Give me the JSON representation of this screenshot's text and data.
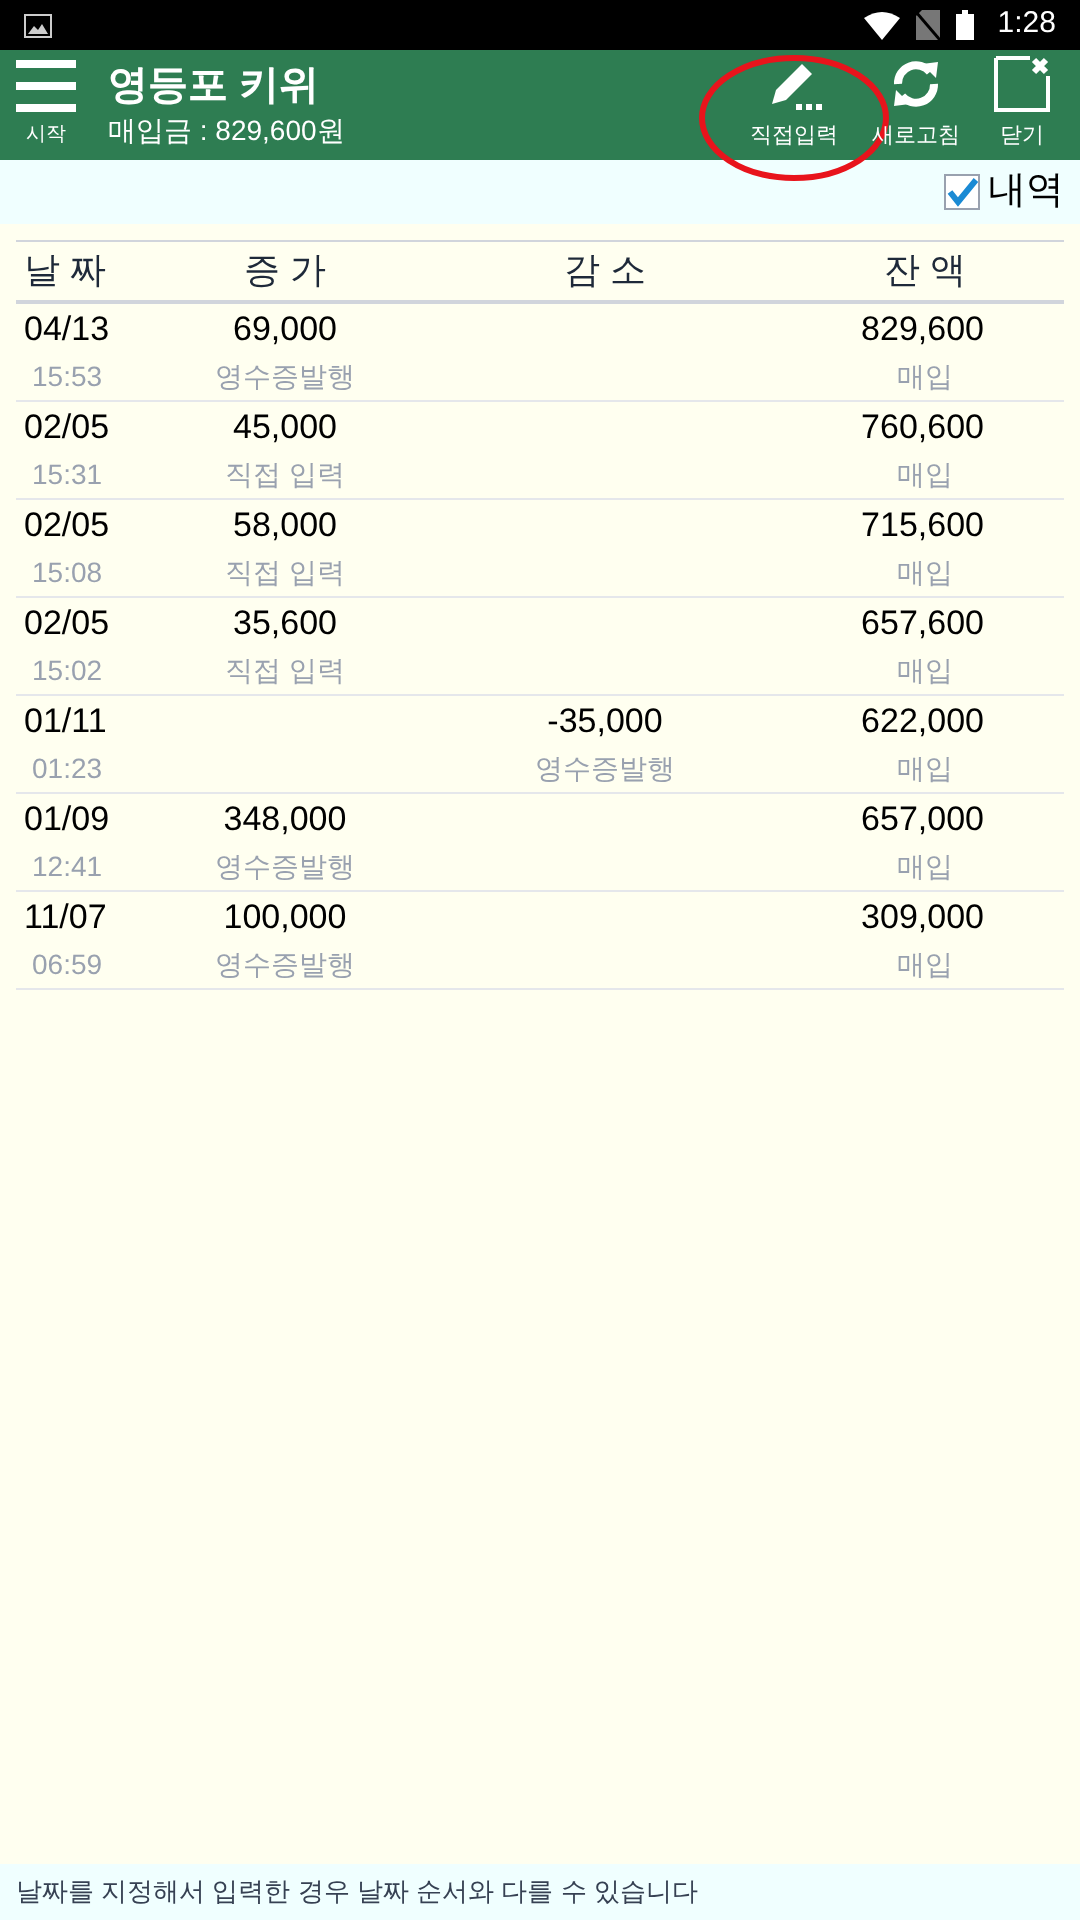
{
  "status_bar": {
    "time": "1:28"
  },
  "app_bar": {
    "menu_label": "시작",
    "title": "영등포 키위",
    "subtitle": "매입금 : 829,600원",
    "actions": [
      {
        "kind": "pencil",
        "label": "직접입력",
        "circled": true
      },
      {
        "kind": "refresh",
        "label": "새로고침",
        "circled": false
      },
      {
        "kind": "close",
        "label": "닫기",
        "circled": false
      }
    ]
  },
  "detail_toggle": {
    "label": "내역",
    "checked": true
  },
  "table": {
    "columns": [
      "날 짜",
      "증 가",
      "감 소",
      "잔 액"
    ],
    "rows": [
      {
        "date": "04/13",
        "time": "15:53",
        "increase": "69,000",
        "increase_note": "영수증발행",
        "decrease": "",
        "decrease_note": "",
        "balance": "829,600",
        "balance_note": "매입"
      },
      {
        "date": "02/05",
        "time": "15:31",
        "increase": "45,000",
        "increase_note": "직접 입력",
        "decrease": "",
        "decrease_note": "",
        "balance": "760,600",
        "balance_note": "매입"
      },
      {
        "date": "02/05",
        "time": "15:08",
        "increase": "58,000",
        "increase_note": "직접 입력",
        "decrease": "",
        "decrease_note": "",
        "balance": "715,600",
        "balance_note": "매입"
      },
      {
        "date": "02/05",
        "time": "15:02",
        "increase": "35,600",
        "increase_note": "직접 입력",
        "decrease": "",
        "decrease_note": "",
        "balance": "657,600",
        "balance_note": "매입"
      },
      {
        "date": "01/11",
        "time": "01:23",
        "increase": "",
        "increase_note": "",
        "decrease": "-35,000",
        "decrease_note": "영수증발행",
        "balance": "622,000",
        "balance_note": "매입"
      },
      {
        "date": "01/09",
        "time": "12:41",
        "increase": "348,000",
        "increase_note": "영수증발행",
        "decrease": "",
        "decrease_note": "",
        "balance": "657,000",
        "balance_note": "매입"
      },
      {
        "date": "11/07",
        "time": "06:59",
        "increase": "100,000",
        "increase_note": "영수증발행",
        "decrease": "",
        "decrease_note": "",
        "balance": "309,000",
        "balance_note": "매입"
      }
    ]
  },
  "footer_note": "날짜를 지정해서 입력한 경우 날짜 순서와 다를 수 있습니다"
}
